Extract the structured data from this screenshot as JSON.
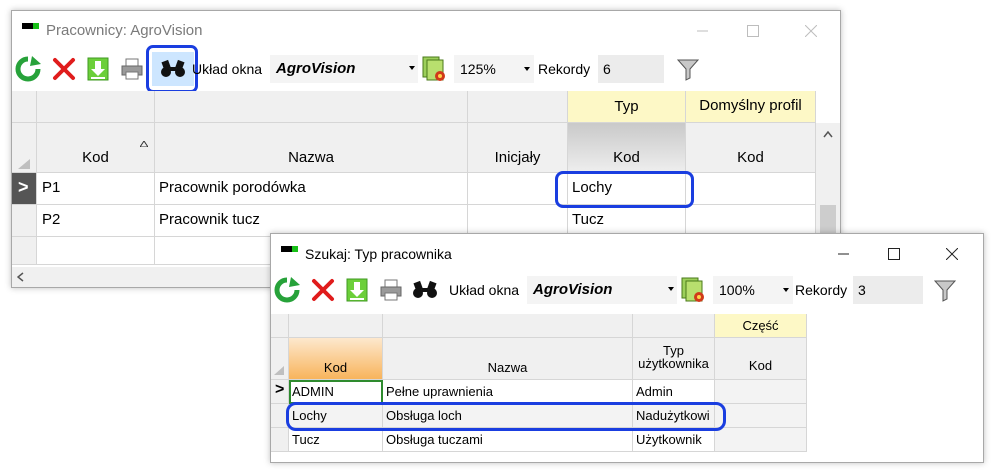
{
  "w1": {
    "title": "Pracownicy: AgroVision",
    "toolbar": {
      "layout_label": "Układ okna",
      "layout_value": "AgroVision",
      "zoom": "125%",
      "records_label": "Rekordy",
      "records_value": "6"
    },
    "grid": {
      "group_typ": "Typ",
      "group_profil": "Domyślny profil",
      "col_kod": "Kod",
      "col_nazwa": "Nazwa",
      "col_inicjaly": "Inicjały",
      "col_typ_kod": "Kod",
      "col_profil_kod": "Kod",
      "rows": [
        {
          "marker": ">",
          "kod": "P1",
          "nazwa": "Pracownik porodówka",
          "inicjaly": "",
          "typ": "Lochy",
          "profil": ""
        },
        {
          "marker": "",
          "kod": "P2",
          "nazwa": "Pracownik tucz",
          "inicjaly": "",
          "typ": "Tucz",
          "profil": ""
        }
      ]
    }
  },
  "w2": {
    "title": "Szukaj: Typ pracownika",
    "toolbar": {
      "layout_label": "Układ okna",
      "layout_value": "AgroVision",
      "zoom": "100%",
      "records_label": "Rekordy",
      "records_value": "3"
    },
    "grid": {
      "group_czesc": "Część",
      "col_kod": "Kod",
      "col_nazwa": "Nazwa",
      "col_typ_1": "Typ",
      "col_typ_2": "użytkownika",
      "col_czesc_kod": "Kod",
      "rows": [
        {
          "marker": ">",
          "kod": "ADMIN",
          "nazwa": "Pełne uprawnienia",
          "typ": "Admin"
        },
        {
          "marker": "",
          "kod": "Lochy",
          "nazwa": "Obsługa loch",
          "typ": "Nadużytkowi"
        },
        {
          "marker": "",
          "kod": "Tucz",
          "nazwa": "Obsługa tuczami",
          "typ": "Użytkownik"
        }
      ]
    }
  },
  "icons": [
    "refresh-icon",
    "delete-icon",
    "download-icon",
    "print-icon",
    "binoculars-icon",
    "layout-settings-icon",
    "filter-icon",
    "minimize-icon",
    "maximize-icon",
    "close-icon"
  ],
  "colors": {
    "highlight": "#1a3ee0",
    "yellow_header": "#fdf8c6",
    "orange_header": "#f8b45c",
    "selected_border": "#2e8b2e"
  }
}
